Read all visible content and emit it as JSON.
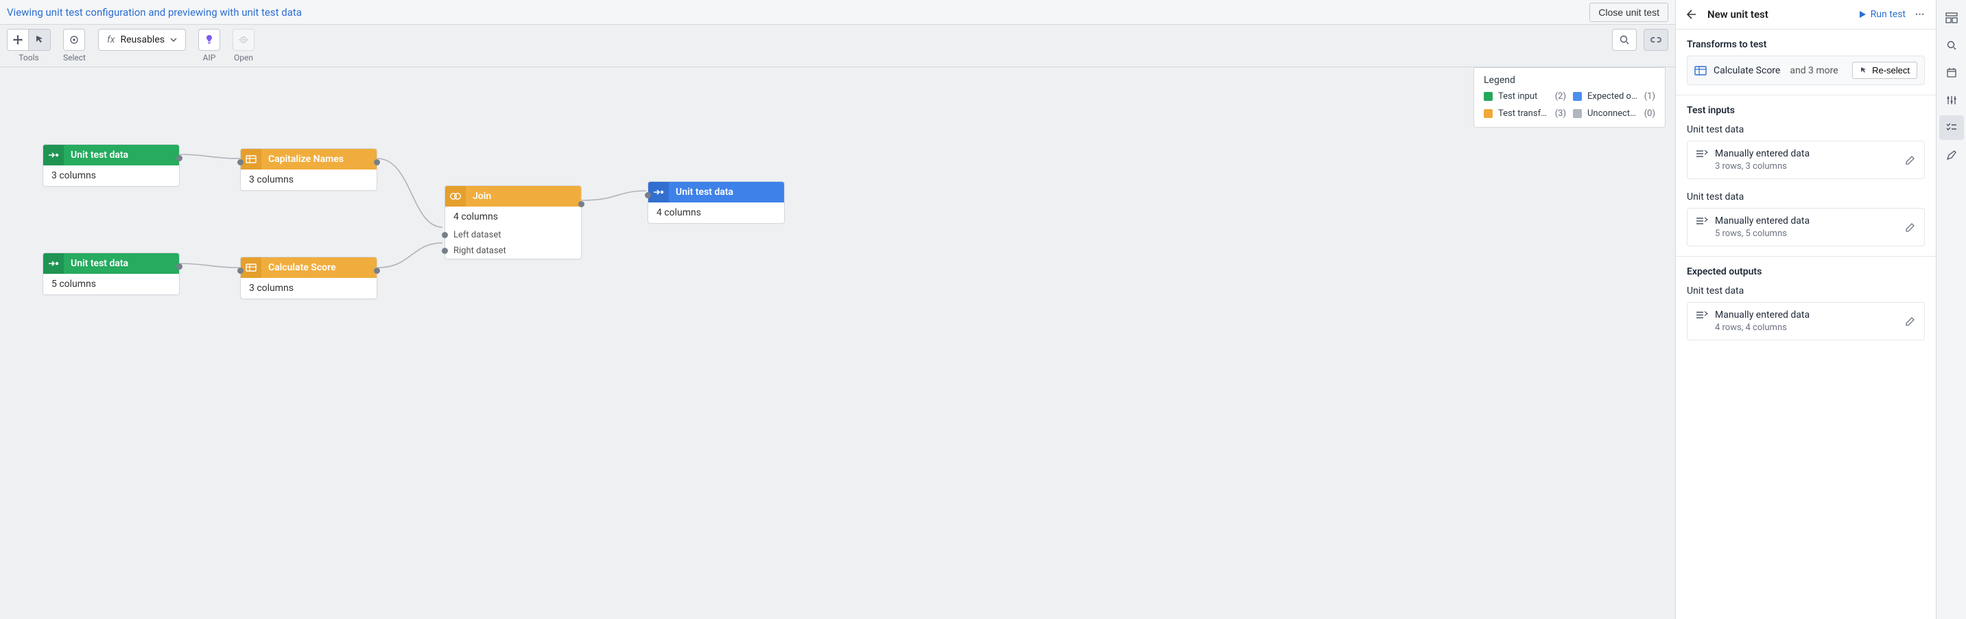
{
  "banner": {
    "text": "Viewing unit test configuration and previewing with unit test data",
    "close_label": "Close unit test"
  },
  "toolbar": {
    "tools_label": "Tools",
    "select_label": "Select",
    "reusables_label": "Reusables",
    "aip_label": "AIP",
    "open_label": "Open"
  },
  "legend": {
    "title": "Legend",
    "items": [
      {
        "label": "Test input",
        "count": "(2)"
      },
      {
        "label": "Expected output",
        "count": "(1)"
      },
      {
        "label": "Test transform",
        "count": "(3)"
      },
      {
        "label": "Unconnected dat…",
        "count": "(0)"
      }
    ]
  },
  "nodes": {
    "in1": {
      "title": "Unit test data",
      "body": "3 columns"
    },
    "in2": {
      "title": "Unit test data",
      "body": "5 columns"
    },
    "t1": {
      "title": "Capitalize Names",
      "body": "3 columns"
    },
    "t2": {
      "title": "Calculate Score",
      "body": "3 columns"
    },
    "join": {
      "title": "Join",
      "body": "4 columns",
      "port_left": "Left dataset",
      "port_right": "Right dataset"
    },
    "out": {
      "title": "Unit test data",
      "body": "4 columns"
    }
  },
  "panel": {
    "title": "New unit test",
    "run_label": "Run test",
    "transforms_heading": "Transforms to test",
    "transform_main": "Calculate Score",
    "transform_more": "and 3 more",
    "reselect_label": "Re-select",
    "inputs_heading": "Test inputs",
    "outputs_heading": "Expected outputs",
    "inputs": [
      {
        "name": "Unit test data",
        "type": "Manually entered data",
        "meta": "3 rows, 3 columns"
      },
      {
        "name": "Unit test data",
        "type": "Manually entered data",
        "meta": "5 rows, 5 columns"
      }
    ],
    "outputs": [
      {
        "name": "Unit test data",
        "type": "Manually entered data",
        "meta": "4 rows, 4 columns"
      }
    ]
  }
}
